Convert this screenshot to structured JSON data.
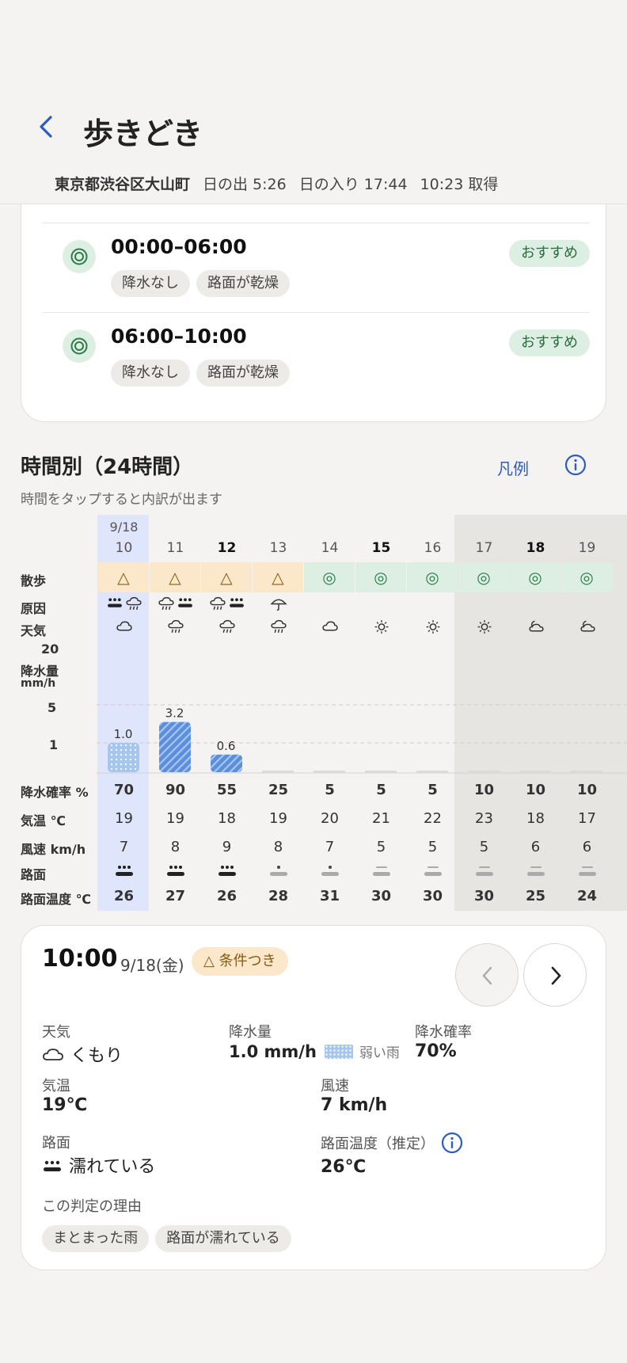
{
  "header": {
    "title": "歩きどき",
    "location": "東京都渋谷区大山町",
    "sunrise": "日の出 5:26",
    "sunset": "日の入り 17:44",
    "fetched": "10:23 取得"
  },
  "slots": [
    {
      "time": "00:00–06:00",
      "chips": [
        "降水なし",
        "路面が乾燥"
      ],
      "badge": "おすすめ"
    },
    {
      "time": "06:00–10:00",
      "chips": [
        "降水なし",
        "路面が乾燥"
      ],
      "badge": "おすすめ"
    }
  ],
  "hourly": {
    "title": "時間別（24時間）",
    "legend_link": "凡例",
    "subtitle": "時間をタップすると内訳が出ます",
    "date_label": "9/18",
    "row_labels": {
      "walk": "散歩",
      "cause": "原因",
      "weather": "天気",
      "precip": "降水量",
      "precip_unit": "mm/h",
      "prob": "降水確率 %",
      "temp": "気温 ℃",
      "wind": "風速 km/h",
      "road": "路面",
      "road_temp": "路面温度 ℃"
    },
    "scale_labels": [
      "20",
      "5",
      "1"
    ],
    "hours": [
      "10",
      "11",
      "12",
      "13",
      "14",
      "15",
      "16",
      "17",
      "18",
      "19"
    ],
    "bold_hours": [
      "12",
      "15",
      "18"
    ],
    "walk": [
      "△",
      "△",
      "△",
      "△",
      "◎",
      "◎",
      "◎",
      "◎",
      "◎",
      "◎"
    ],
    "weather_icons": [
      "cloud-icon",
      "rain-cloud-icon",
      "rain-cloud-icon",
      "rain-cloud-icon",
      "cloud-icon",
      "sun-icon",
      "sun-icon",
      "sun-icon",
      "moon-cloud-icon",
      "moon-cloud-icon"
    ],
    "precip_values": [
      1.0,
      3.2,
      0.6,
      0,
      0,
      0,
      0,
      0,
      0,
      0
    ],
    "precip_labels": [
      "1.0",
      "3.2",
      "0.6",
      "",
      "",
      "",
      "",
      "",
      "",
      ""
    ],
    "prob": [
      "70",
      "90",
      "55",
      "25",
      "5",
      "5",
      "5",
      "10",
      "10",
      "10"
    ],
    "temp": [
      "19",
      "19",
      "18",
      "19",
      "20",
      "21",
      "22",
      "23",
      "18",
      "17"
    ],
    "wind": [
      "7",
      "8",
      "9",
      "8",
      "7",
      "5",
      "5",
      "5",
      "6",
      "6"
    ],
    "road_state": [
      "wet",
      "wet",
      "wet",
      "damp",
      "damp",
      "dry",
      "dry",
      "dry",
      "dry",
      "dry"
    ],
    "road_temp": [
      "26",
      "27",
      "26",
      "28",
      "31",
      "30",
      "30",
      "30",
      "25",
      "24"
    ]
  },
  "detail": {
    "time": "10:00",
    "date": "9/18(金)",
    "badge": "△ 条件つき",
    "weather_label": "天気",
    "weather_value": "くもり",
    "precip_label": "降水量",
    "precip_value": "1.0 mm/h",
    "precip_note": "弱い雨",
    "prob_label": "降水確率",
    "prob_value": "70%",
    "temp_label": "気温",
    "temp_value": "19℃",
    "wind_label": "風速",
    "wind_value": "7 km/h",
    "road_label": "路面",
    "road_value": "濡れている",
    "road_temp_label": "路面温度（推定）",
    "road_temp_value": "26℃",
    "reason_label": "この判定の理由",
    "reasons": [
      "まとまった雨",
      "路面が濡れている"
    ]
  },
  "colors": {
    "accent": "#2a5cc2",
    "recommend_bg": "#dcefe2",
    "caution_bg": "#fbe7c9",
    "selected_col": "#dfe5fb",
    "night_col": "#e6e5e2"
  }
}
